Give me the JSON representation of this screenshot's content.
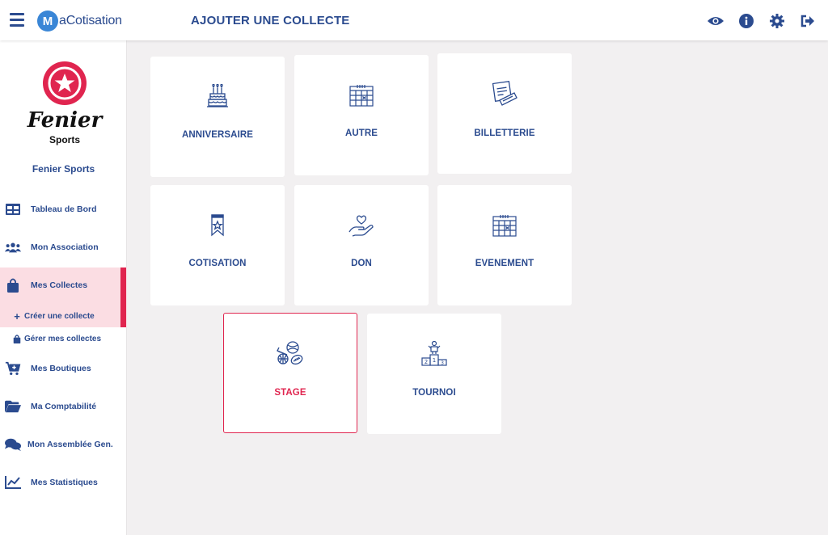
{
  "header": {
    "app_name": "aCotisation",
    "app_mark": "M",
    "title": "AJOUTER UNE COLLECTE",
    "icons": [
      "eye-icon",
      "info-icon",
      "gear-icon",
      "logout-icon"
    ]
  },
  "sidebar": {
    "club": {
      "script": "Fenier",
      "sub": "Sports",
      "name": "Fenier Sports"
    },
    "items": [
      {
        "label": "Tableau de Bord",
        "icon": "dashboard-icon"
      },
      {
        "label": "Mon Association",
        "icon": "users-icon"
      },
      {
        "label": "Mes Collectes",
        "icon": "bag-icon"
      },
      {
        "label": "Mes Boutiques",
        "icon": "cart-icon"
      },
      {
        "label": "Ma Comptabilité",
        "icon": "folder-icon"
      },
      {
        "label": "Mon Assemblée Gen.",
        "icon": "chat-icon"
      },
      {
        "label": "Mes Statistiques",
        "icon": "chart-icon"
      }
    ],
    "sub_items": [
      {
        "label": "Créer une collecte",
        "icon": "plus-icon",
        "glyph": "+"
      },
      {
        "label": "Gérer mes collectes",
        "icon": "bag-icon"
      }
    ]
  },
  "cards": [
    {
      "label": "ANNIVERSAIRE",
      "icon": "cake-icon"
    },
    {
      "label": "AUTRE",
      "icon": "calendar-icon"
    },
    {
      "label": "BILLETTERIE",
      "icon": "tickets-icon"
    },
    {
      "label": "COTISATION",
      "icon": "bookmark-star-icon"
    },
    {
      "label": "DON",
      "icon": "heart-hand-icon"
    },
    {
      "label": "EVENEMENT",
      "icon": "calendar-icon"
    },
    {
      "label": "STAGE",
      "icon": "sports-balls-icon"
    },
    {
      "label": "TOURNOI",
      "icon": "podium-icon"
    }
  ],
  "podium_digits": [
    "2",
    "1",
    "3"
  ],
  "colors": {
    "primary": "#2b4b8f",
    "accent": "#e0254f",
    "active_bg": "#fbdde3",
    "background": "#f2f0f1"
  }
}
